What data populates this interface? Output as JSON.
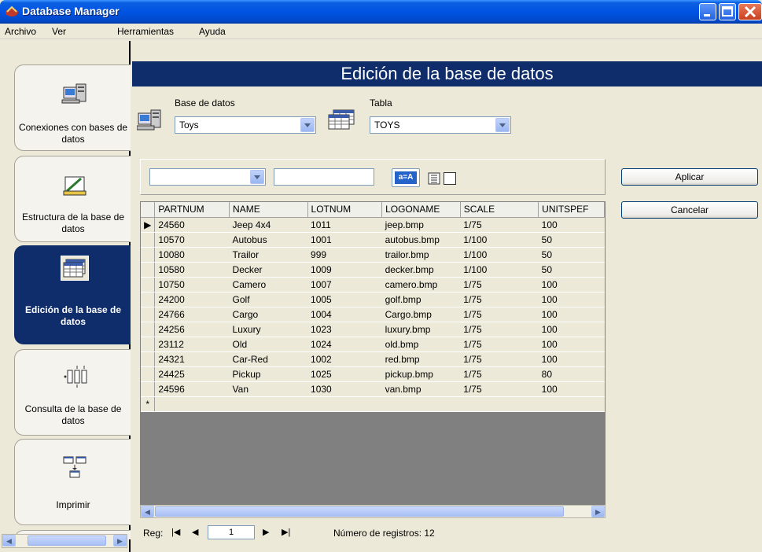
{
  "window": {
    "title": "Database Manager"
  },
  "menu": [
    "Archivo",
    "Ver",
    "Herramientas",
    "Ayuda"
  ],
  "sidebar": {
    "items": [
      {
        "label": "Conexiones con bases de datos",
        "icon": "database-connections-icon",
        "active": false
      },
      {
        "label": "Estructura de la base de datos",
        "icon": "database-structure-icon",
        "active": false
      },
      {
        "label": "Edición de la base de datos",
        "icon": "database-edit-icon",
        "active": true
      },
      {
        "label": "Consulta de la base de datos",
        "icon": "database-query-icon",
        "active": false
      },
      {
        "label": "Imprimir",
        "icon": "print-icon",
        "active": false
      }
    ]
  },
  "main": {
    "header": "Edición de la base de datos",
    "database_label": "Base de datos",
    "database_value": "Toys",
    "table_label": "Tabla",
    "table_value": "TOYS",
    "filter_field_value": "",
    "filter_text_value": "",
    "filter_button_icon": "a=A",
    "apply_label": "Aplicar",
    "cancel_label": "Cancelar"
  },
  "grid": {
    "columns": [
      "PARTNUM",
      "NAME",
      "LOTNUM",
      "LOGONAME",
      "SCALE",
      "UNITSPEF"
    ],
    "rows": [
      [
        "24560",
        "Jeep 4x4",
        "1011",
        "jeep.bmp",
        "1/75",
        "100"
      ],
      [
        "10570",
        "Autobus",
        "1001",
        "autobus.bmp",
        "1/100",
        "50"
      ],
      [
        "10080",
        "Trailor",
        "999",
        "trailor.bmp",
        "1/100",
        "50"
      ],
      [
        "10580",
        "Decker",
        "1009",
        "decker.bmp",
        "1/100",
        "50"
      ],
      [
        "10750",
        "Camero",
        "1007",
        "camero.bmp",
        "1/75",
        "100"
      ],
      [
        "24200",
        "Golf",
        "1005",
        "golf.bmp",
        "1/75",
        "100"
      ],
      [
        "24766",
        "Cargo",
        "1004",
        "Cargo.bmp",
        "1/75",
        "100"
      ],
      [
        "24256",
        "Luxury",
        "1023",
        "luxury.bmp",
        "1/75",
        "100"
      ],
      [
        "23112",
        "Old",
        "1024",
        "old.bmp",
        "1/75",
        "100"
      ],
      [
        "24321",
        "Car-Red",
        "1002",
        "red.bmp",
        "1/75",
        "100"
      ],
      [
        "24425",
        "Pickup",
        "1025",
        "pickup.bmp",
        "1/75",
        "80"
      ],
      [
        "24596",
        "Van",
        "1030",
        "van.bmp",
        "1/75",
        "100"
      ]
    ],
    "current_row_marker": "▶",
    "new_row_marker": "*"
  },
  "navigator": {
    "label": "Reg:",
    "current": "1",
    "count_text": "Número de registros: 12"
  }
}
